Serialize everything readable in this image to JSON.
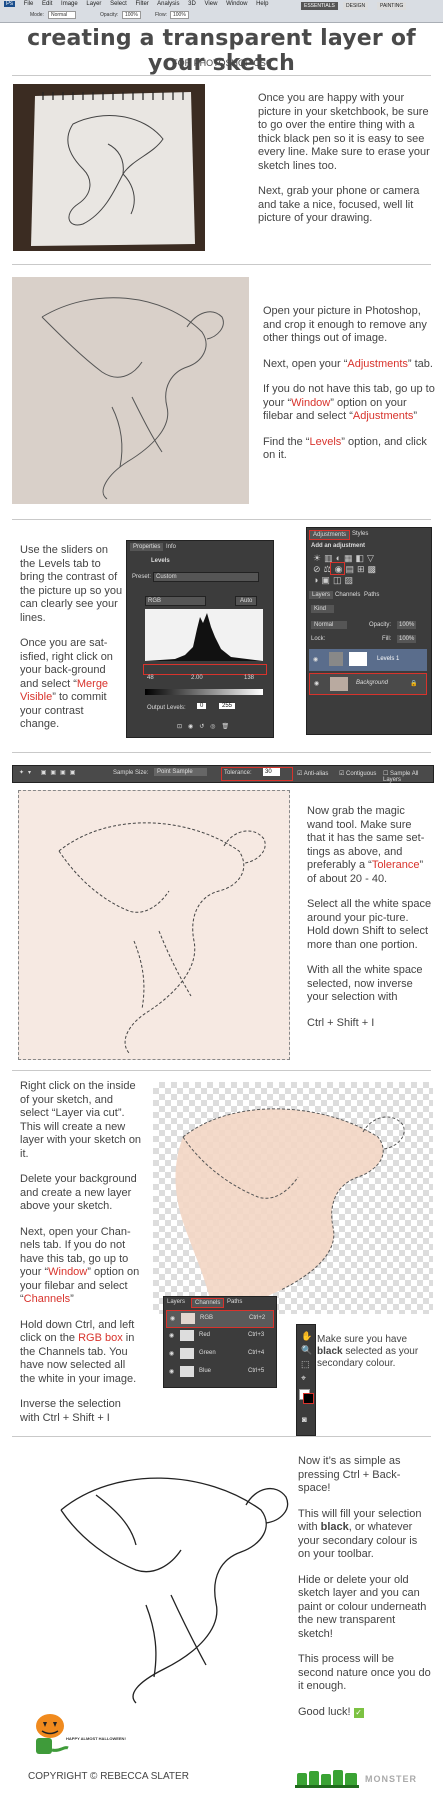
{
  "app": {
    "menu": [
      "Ps",
      "File",
      "Edit",
      "Image",
      "Layer",
      "Select",
      "Filter",
      "Analysis",
      "3D",
      "View",
      "Window",
      "Help"
    ],
    "options": {
      "mode_label": "Mode:",
      "mode_value": "Normal",
      "opacity_label": "Opacity:",
      "opacity_value": "100%",
      "flow_label": "Flow:",
      "flow_value": "100%"
    },
    "workspaces": [
      "ESSENTIALS",
      "DESIGN",
      "PAINTING"
    ]
  },
  "header": {
    "title": "creating a transparent layer of your sketch",
    "subtitle": "FOR PHOTOSHOP CS6"
  },
  "step1": {
    "p1": "Once you are happy with your picture in your sketchbook, be sure to go over the entire thing with a thick black pen so it is easy to see every line. Make sure to erase your sketch lines too.",
    "p2": "Next, grab your phone or camera and take a nice, focused, well lit picture of your drawing."
  },
  "step2": {
    "p1": "Open your picture in Photoshop, and crop it enough to remove any other things out of image.",
    "p2_a": "Next, open your “",
    "p2_red": "Adjustments",
    "p2_b": "” tab.",
    "p3_a": "If you do not have this tab, go up to your “",
    "p3_red1": "Window",
    "p3_b": "” option on your filebar and select “",
    "p3_red2": "Adjustments",
    "p3_c": "”",
    "p4_a": "Find the “",
    "p4_red": "Levels",
    "p4_b": "” option, and click on it."
  },
  "step3": {
    "p1": "Use the sliders on the Levels tab to bring the contrast of the picture up so you can clearly see your lines.",
    "p2_a": "Once you are sat-isfied, right click on your back-ground and select “",
    "p2_red": "Merge Visible",
    "p2_b": "” to commit your contrast change."
  },
  "levels_panel": {
    "tabs": [
      "Properties",
      "Info"
    ],
    "name": "Levels",
    "preset_label": "Preset:",
    "preset_value": "Custom",
    "channel": "RGB",
    "auto": "Auto",
    "input": [
      "48",
      "2.00",
      "138"
    ],
    "output_label": "Output Levels:",
    "output": [
      "0",
      "255"
    ]
  },
  "adjust_panel": {
    "tabs": [
      "Adjustments",
      "Styles"
    ],
    "add_label": "Add an adjustment",
    "layer_tabs": [
      "Layers",
      "Channels",
      "Paths"
    ],
    "kind": "Kind",
    "blend": "Normal",
    "opacity_label": "Opacity:",
    "opacity": "100%",
    "lock_label": "Lock:",
    "fill_label": "Fill:",
    "fill": "100%",
    "layers": [
      "Levels 1",
      "Background"
    ]
  },
  "wand_bar": {
    "sample_label": "Sample Size:",
    "sample_value": "Point Sample",
    "tolerance_label": "Tolerance:",
    "tolerance_value": "30",
    "anti_alias": "Anti-alias",
    "contiguous": "Contiguous",
    "sample_all": "Sample All Layers"
  },
  "step4": {
    "p1_a": "Now grab the magic wand tool. Make sure that it has the same set-tings as above, and preferably a “",
    "p1_red": "Tolerance",
    "p1_b": "” of about 20 - 40.",
    "p2": "Select all the white space around your pic-ture. Hold down Shift to select more than one portion.",
    "p3": "With all the white space selected, now inverse your selection with",
    "p4": "Ctrl + Shift + I"
  },
  "step5": {
    "p1": "Right click on the inside of your sketch, and select “Layer via cut”. This will create a new layer with your sketch on it.",
    "p2": "Delete your background and create a new layer above your sketch.",
    "p3_a": "Next, open your Chan-nels tab. If you do not have this tab, go up to your “",
    "p3_red1": "Window",
    "p3_b": "” option on your filebar and select “",
    "p3_red2": "Channels",
    "p3_c": "”",
    "p4_a": "Hold down Ctrl, and left click on the ",
    "p4_red": "RGB box",
    "p4_b": " in the Channels tab. You have now selected all the white in your image.",
    "p5": "Inverse the selection with Ctrl + Shift + I"
  },
  "channels_panel": {
    "tabs": [
      "Layers",
      "Channels",
      "Paths"
    ],
    "rows": [
      {
        "name": "RGB",
        "key": "Ctrl+2"
      },
      {
        "name": "Red",
        "key": "Ctrl+3"
      },
      {
        "name": "Green",
        "key": "Ctrl+4"
      },
      {
        "name": "Blue",
        "key": "Ctrl+5"
      }
    ]
  },
  "colour_note": {
    "a": "Make sure you have ",
    "b": "black",
    "c": " selected as your secondary colour."
  },
  "step6": {
    "p1": "Now it’s as simple as pressing Ctrl + Back-space!",
    "p2_a": "This will fill your selection with ",
    "p2_b": "black",
    "p2_c": ", or whatever your secondary colour is on your toolbar.",
    "p3": "Hide or delete your old sketch layer and you can paint or colour underneath the new transparent sketch!",
    "p4": "This process will be second nature once you do it enough.",
    "p5": "Good luck!"
  },
  "footer": {
    "badge": "HAPPY ALMOST HALLOWEEN!",
    "copyright": "COPYRIGHT © REBECCA SLATER",
    "logo": "MONSTER"
  },
  "colors": {
    "accent_red": "#d8332c",
    "panel_dark": "#3c3c3c",
    "text": "#444444",
    "divider": "#c9c9c9"
  }
}
